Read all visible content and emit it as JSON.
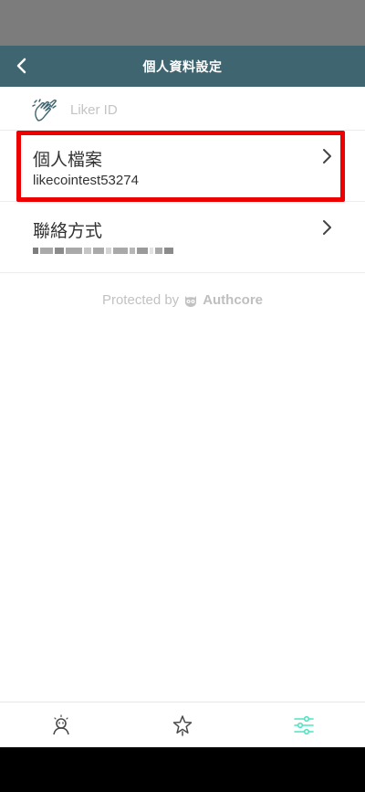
{
  "header": {
    "title": "個人資料設定",
    "back_icon": "chevron-left-icon"
  },
  "liker_row": {
    "label": "Liker ID",
    "icon": "clapping-hands-icon"
  },
  "profile_row": {
    "title": "個人檔案",
    "subtitle": "likecointest53274",
    "icon": "chevron-right-icon"
  },
  "contact_row": {
    "title": "聯絡方式",
    "subtitle_redacted": true,
    "icon": "chevron-right-icon"
  },
  "footer": {
    "prefix": "Protected by",
    "brand": "Authcore",
    "brand_icon": "owl-icon"
  },
  "tabs": [
    {
      "name": "profile",
      "icon": "person-icon",
      "active": false
    },
    {
      "name": "favorites",
      "icon": "star-icon",
      "active": false
    },
    {
      "name": "settings",
      "icon": "sliders-icon",
      "active": true
    }
  ],
  "colors": {
    "nav": "#3f6570",
    "highlight": "#ee0000",
    "active_tab": "#50e3c2",
    "inactive_tab": "#4a4a4a"
  }
}
